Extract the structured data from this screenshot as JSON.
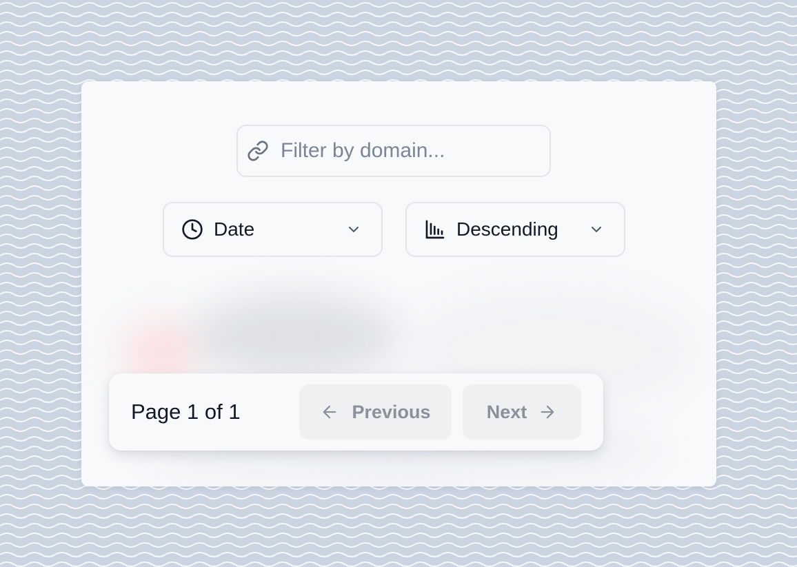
{
  "filter": {
    "placeholder": "Filter by domain...",
    "value": "",
    "icon": "link-icon"
  },
  "sort_field": {
    "selected": "Date",
    "icon": "clock-icon"
  },
  "sort_order": {
    "selected": "Descending",
    "icon": "bar-chart-icon"
  },
  "pagination": {
    "info": "Page 1 of 1",
    "previous_label": "Previous",
    "next_label": "Next"
  },
  "colors": {
    "background": "#cbd4e1",
    "card": "#f8f9fb",
    "muted_text": "#8a919b",
    "disabled_button": "#eff0f2"
  }
}
